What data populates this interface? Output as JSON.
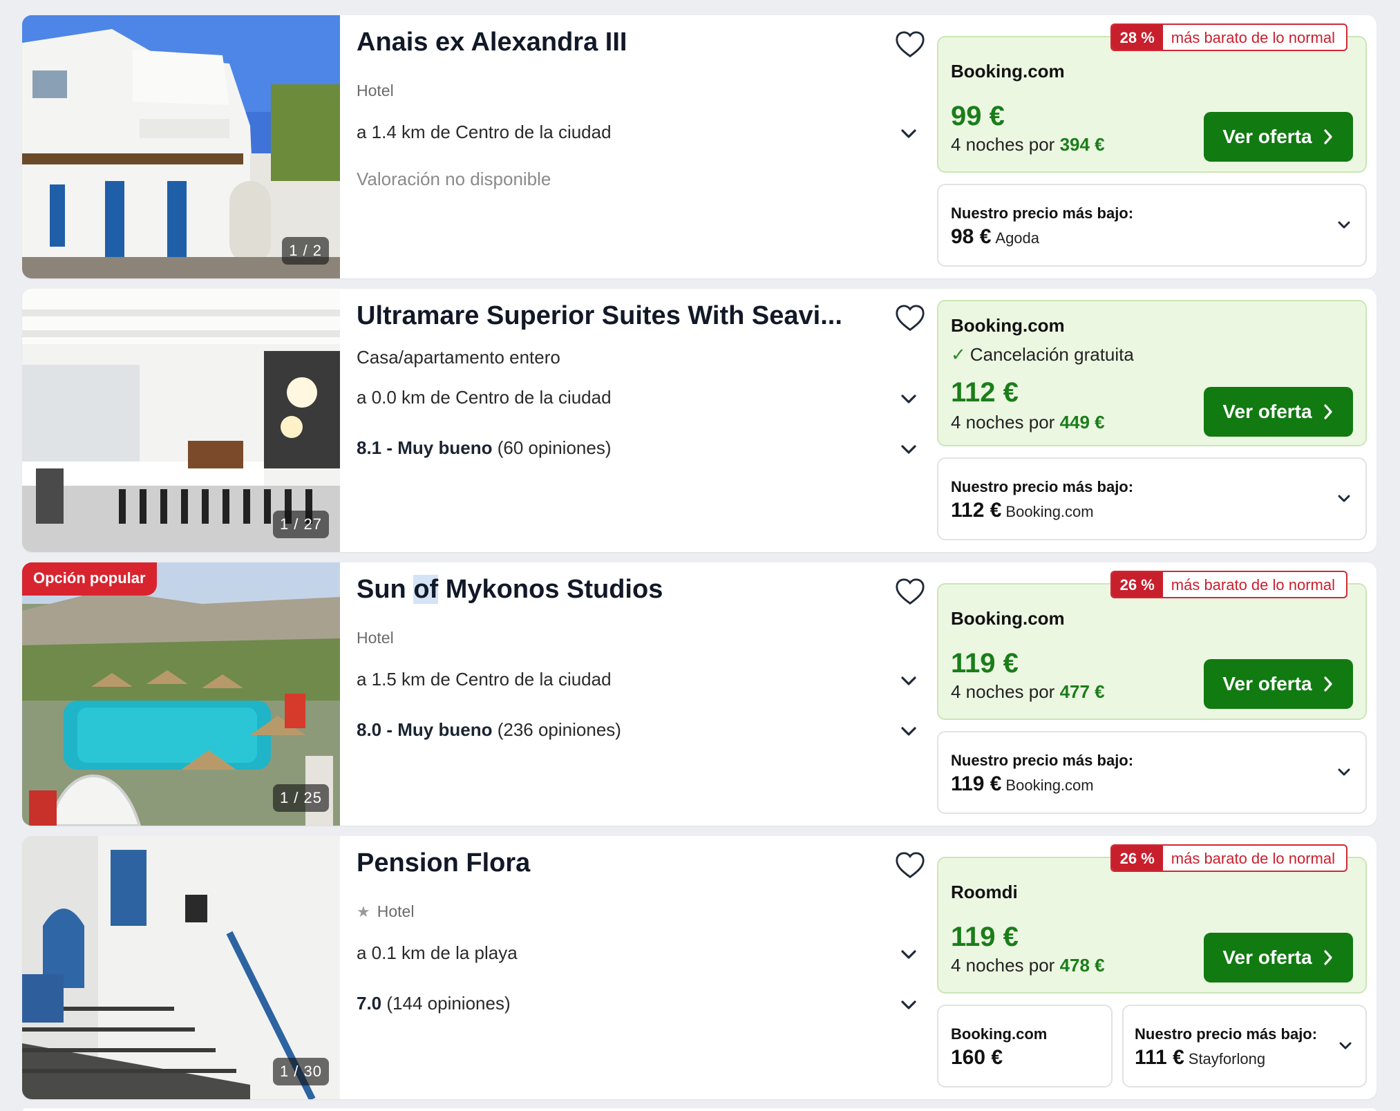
{
  "colors": {
    "price_green": "#1b7d1a",
    "cta_green": "#117a11",
    "discount_red": "#c81f2d",
    "deal_bg": "#ecf7e2"
  },
  "listings": [
    {
      "name": "Anais ex Alexandra III",
      "type": "Hotel",
      "distance": "a 1.4 km de Centro de la ciudad",
      "rating_na": "Valoración no disponible",
      "photo_counter": "1 / 2",
      "discount": {
        "pct": "28 %",
        "text": "más barato de lo normal"
      },
      "deal": {
        "provider": "Booking.com",
        "price": "99 €",
        "nights_prefix": "4 noches por",
        "total": "394 €",
        "cta": "Ver oferta"
      },
      "lowest": {
        "label": "Nuestro precio más bajo:",
        "price": "98 €",
        "source": "Agoda"
      },
      "icons": {
        "favorite": "heart-icon",
        "expand": "chevron-down-icon"
      }
    },
    {
      "name": "Ultramare Superior Suites With Seavi...",
      "type": "Casa/apartamento entero",
      "distance": "a 0.0 km de Centro de la ciudad",
      "rating": {
        "score": "8.1 - Muy bueno",
        "reviews": "(60 opiniones)"
      },
      "photo_counter": "1 / 27",
      "deal": {
        "provider": "Booking.com",
        "cancellation": "Cancelación gratuita",
        "price": "112 €",
        "nights_prefix": "4 noches por",
        "total": "449 €",
        "cta": "Ver oferta"
      },
      "lowest": {
        "label": "Nuestro precio más bajo:",
        "price": "112 €",
        "source": "Booking.com"
      }
    },
    {
      "name_parts": [
        "Sun ",
        "of",
        " Mykonos Studios"
      ],
      "popular_badge": "Opción popular",
      "type": "Hotel",
      "distance": "a 1.5 km de Centro de la ciudad",
      "rating": {
        "score": "8.0 - Muy bueno",
        "reviews": "(236 opiniones)"
      },
      "photo_counter": "1 / 25",
      "discount": {
        "pct": "26 %",
        "text": "más barato de lo normal"
      },
      "deal": {
        "provider": "Booking.com",
        "price": "119 €",
        "nights_prefix": "4 noches por",
        "total": "477 €",
        "cta": "Ver oferta"
      },
      "lowest": {
        "label": "Nuestro precio más bajo:",
        "price": "119 €",
        "source": "Booking.com"
      }
    },
    {
      "name": "Pension Flora",
      "stars": "★",
      "type": "Hotel",
      "distance": "a 0.1 km de la playa",
      "rating": {
        "score": "7.0",
        "reviews": "(144 opiniones)"
      },
      "photo_counter": "1 / 30",
      "discount": {
        "pct": "26 %",
        "text": "más barato de lo normal"
      },
      "deal": {
        "provider": "Roomdi",
        "price": "119 €",
        "nights_prefix": "4 noches por",
        "total": "478 €",
        "cta": "Ver oferta"
      },
      "alt": {
        "provider": "Booking.com",
        "price": "160 €"
      },
      "lowest": {
        "label": "Nuestro precio más bajo:",
        "price": "111 €",
        "source": "Stayforlong"
      }
    }
  ]
}
